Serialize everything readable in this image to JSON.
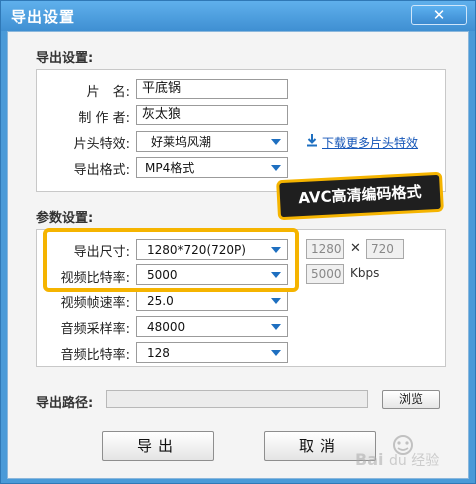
{
  "window": {
    "title": "导出设置",
    "close_glyph": "✕"
  },
  "export_section": {
    "label": "导出设置:",
    "name_label": "片　名:",
    "name_value": "平底锅",
    "author_label": "制 作 者:",
    "author_value": "灰太狼",
    "intro_label": "片头特效:",
    "intro_value": "好莱坞风潮",
    "format_label": "导出格式:",
    "format_value": "MP4格式",
    "download_link": "下载更多片头特效"
  },
  "callout": {
    "text": "AVC高清编码格式"
  },
  "params_section": {
    "label": "参数设置:",
    "size_label": "导出尺寸:",
    "size_value": "1280*720(720P)",
    "width_value": "1280",
    "height_value": "720",
    "vbitrate_label": "视频比特率:",
    "vbitrate_value": "5000",
    "vbitrate_box": "5000",
    "vbitrate_unit": "Kbps",
    "framerate_label": "视频帧速率:",
    "framerate_value": "25.0",
    "samplerate_label": "音频采样率:",
    "samplerate_value": "48000",
    "abitrate_label": "音频比特率:",
    "abitrate_value": "128"
  },
  "path": {
    "label": "导出路径:",
    "value": "",
    "browse_label": "浏览"
  },
  "buttons": {
    "export_label": "导出",
    "cancel_label": "取消"
  },
  "colors": {
    "titlebar": "#4a9ad8",
    "highlight": "#f5b400",
    "link": "#1556b8"
  }
}
